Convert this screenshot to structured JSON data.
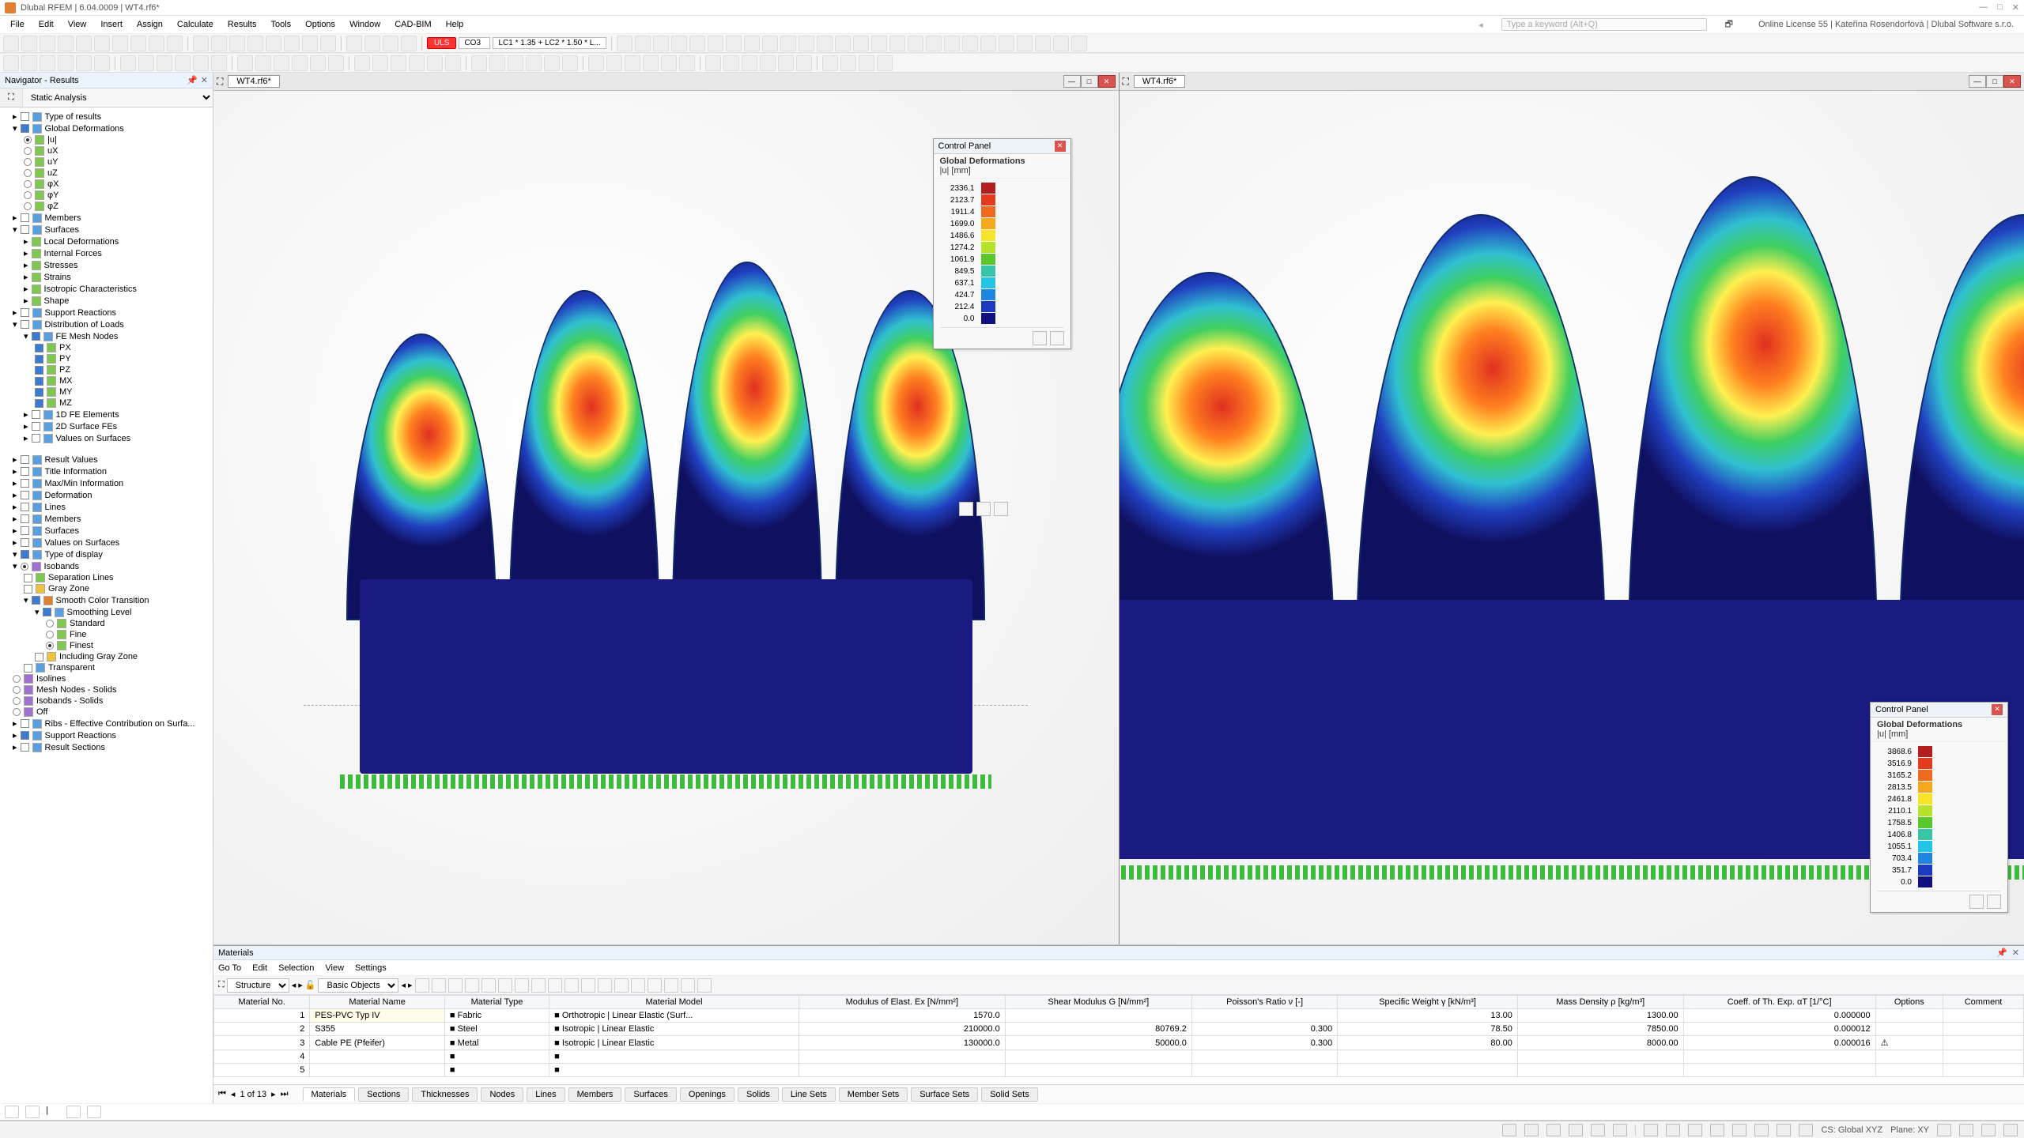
{
  "app": {
    "title": "Dlubal RFEM | 6.04.0009 | WT4.rf6*"
  },
  "titlebar_controls": [
    "—",
    "□",
    "✕"
  ],
  "menubar": [
    "File",
    "Edit",
    "View",
    "Insert",
    "Assign",
    "Calculate",
    "Results",
    "Tools",
    "Options",
    "Window",
    "CAD-BIM",
    "Help"
  ],
  "search_placeholder": "Type a keyword (Alt+Q)",
  "license_info": "Online License 55 | Kateřina Rosendorfová | Dlubal Software s.r.o.",
  "toolbar_combo": {
    "uls_tag": "ULS",
    "co": "CO3",
    "formula": "LC1 * 1.35 + LC2 * 1.50 * L..."
  },
  "navigator": {
    "title": "Navigator - Results",
    "tab": "Static Analysis",
    "tree": {
      "type_of_results": "Type of results",
      "global_def": "Global Deformations",
      "global_def_items": [
        "|u|",
        "uX",
        "uY",
        "uZ",
        "φX",
        "φY",
        "φZ"
      ],
      "members": "Members",
      "surfaces": "Surfaces",
      "surface_items": [
        "Local Deformations",
        "Internal Forces",
        "Stresses",
        "Strains",
        "Isotropic Characteristics",
        "Shape"
      ],
      "support": "Support Reactions",
      "distribution": "Distribution of Loads",
      "fe_mesh": "FE Mesh Nodes",
      "fe_mesh_items": [
        "PX",
        "PY",
        "PZ",
        "MX",
        "MY",
        "MZ"
      ],
      "fe_1d": "1D FE Elements",
      "fe_2d": "2D Surface FEs",
      "v_on_surf": "Values on Surfaces",
      "panel2": [
        "Result Values",
        "Title Information",
        "Max/Min Information",
        "Deformation",
        "Lines",
        "Members",
        "Surfaces",
        "Values on Surfaces",
        "Type of display"
      ],
      "isobands": "Isobands",
      "iso_items": [
        "Separation Lines",
        "Gray Zone",
        "Smooth Color Transition"
      ],
      "smoothing": "Smoothing Level",
      "smooth_items": [
        "Standard",
        "Fine",
        "Finest"
      ],
      "include_gray": "Including Gray Zone",
      "transparent": "Transparent",
      "isolines": "Isolines",
      "mesh_nodes_solids": "Mesh Nodes - Solids",
      "iso_solids": "Isobands - Solids",
      "off": "Off",
      "ribs": "Ribs - Effective Contribution on Surfa...",
      "support2": "Support Reactions",
      "result_sections": "Result Sections"
    }
  },
  "viewport": {
    "tab_title": "WT4.rf6*",
    "control_panel": "Control Panel",
    "cp_sub1": "Global Deformations",
    "cp_sub2": "|u| [mm]",
    "legend_left": {
      "vals": [
        "2336.1",
        "2123.7",
        "1911.4",
        "1699.0",
        "1486.6",
        "1274.2",
        "1061.9",
        "849.5",
        "637.1",
        "424.7",
        "212.4",
        "0.0"
      ]
    },
    "legend_right": {
      "vals": [
        "3868.6",
        "3516.9",
        "3165.2",
        "2813.5",
        "2461.8",
        "2110.1",
        "1758.5",
        "1406.8",
        "1055.1",
        "703.4",
        "351.7",
        "0.0"
      ]
    }
  },
  "legend_colors": [
    "#b31e1e",
    "#e43a1e",
    "#ef6a1e",
    "#f4a81e",
    "#f5e42a",
    "#b7e22a",
    "#5ac72c",
    "#36c6a7",
    "#24c4e6",
    "#1e86e0",
    "#1b3ac1",
    "#101080"
  ],
  "materials": {
    "title": "Materials",
    "menus": [
      "Go To",
      "Edit",
      "Selection",
      "View",
      "Settings"
    ],
    "combo1": "Structure",
    "combo2": "Basic Objects",
    "headers": [
      "Material No.",
      "Material Name",
      "Material Type",
      "Material Model",
      "Modulus of Elast. Ex [N/mm²]",
      "Shear Modulus G [N/mm²]",
      "Poisson's Ratio ν [-]",
      "Specific Weight γ [kN/m³]",
      "Mass Density ρ [kg/m³]",
      "Coeff. of Th. Exp. αT [1/°C]",
      "Options",
      "Comment"
    ],
    "rows": [
      {
        "no": "1",
        "name": "PES-PVC Typ IV",
        "type": "Fabric",
        "model": "Orthotropic | Linear Elastic (Surf...",
        "E": "1570.0",
        "G": "",
        "v": "",
        "gamma": "13.00",
        "rho": "1300.00",
        "alpha": "0.000000",
        "opt": "",
        "comment": ""
      },
      {
        "no": "2",
        "name": "S355",
        "type": "Steel",
        "model": "Isotropic | Linear Elastic",
        "E": "210000.0",
        "G": "80769.2",
        "v": "0.300",
        "gamma": "78.50",
        "rho": "7850.00",
        "alpha": "0.000012",
        "opt": "",
        "comment": ""
      },
      {
        "no": "3",
        "name": "Cable PE (Pfeifer)",
        "type": "Metal",
        "model": "Isotropic | Linear Elastic",
        "E": "130000.0",
        "G": "50000.0",
        "v": "0.300",
        "gamma": "80.00",
        "rho": "8000.00",
        "alpha": "0.000016",
        "opt": "⚠",
        "comment": ""
      },
      {
        "no": "4",
        "name": "",
        "type": "",
        "model": "",
        "E": "",
        "G": "",
        "v": "",
        "gamma": "",
        "rho": "",
        "alpha": "",
        "opt": "",
        "comment": ""
      },
      {
        "no": "5",
        "name": "",
        "type": "",
        "model": "",
        "E": "",
        "G": "",
        "v": "",
        "gamma": "",
        "rho": "",
        "alpha": "",
        "opt": "",
        "comment": ""
      }
    ],
    "pager": "1 of 13",
    "tabs": [
      "Materials",
      "Sections",
      "Thicknesses",
      "Nodes",
      "Lines",
      "Members",
      "Surfaces",
      "Openings",
      "Solids",
      "Line Sets",
      "Member Sets",
      "Surface Sets",
      "Solid Sets"
    ]
  },
  "status": {
    "cs": "CS: Global XYZ",
    "plane": "Plane: XY"
  }
}
